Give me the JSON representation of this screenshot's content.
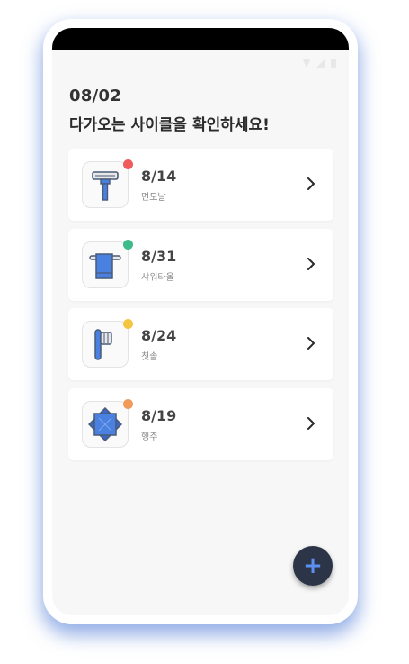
{
  "header": {
    "date": "08/02",
    "headline": "다가오는 사이클을 확인하세요!"
  },
  "items": [
    {
      "date": "8/14",
      "label": "면도날",
      "icon": "razor-icon",
      "dot_color": "#ef5b5b"
    },
    {
      "date": "8/31",
      "label": "샤워타올",
      "icon": "towel-icon",
      "dot_color": "#3dbb8a"
    },
    {
      "date": "8/24",
      "label": "칫솔",
      "icon": "toothbrush-icon",
      "dot_color": "#f5c542"
    },
    {
      "date": "8/19",
      "label": "행주",
      "icon": "dishcloth-icon",
      "dot_color": "#f29a5a"
    }
  ],
  "fab": {
    "label": "+"
  },
  "colors": {
    "accent": "#4a80e0",
    "fab_bg": "#2c3547"
  }
}
